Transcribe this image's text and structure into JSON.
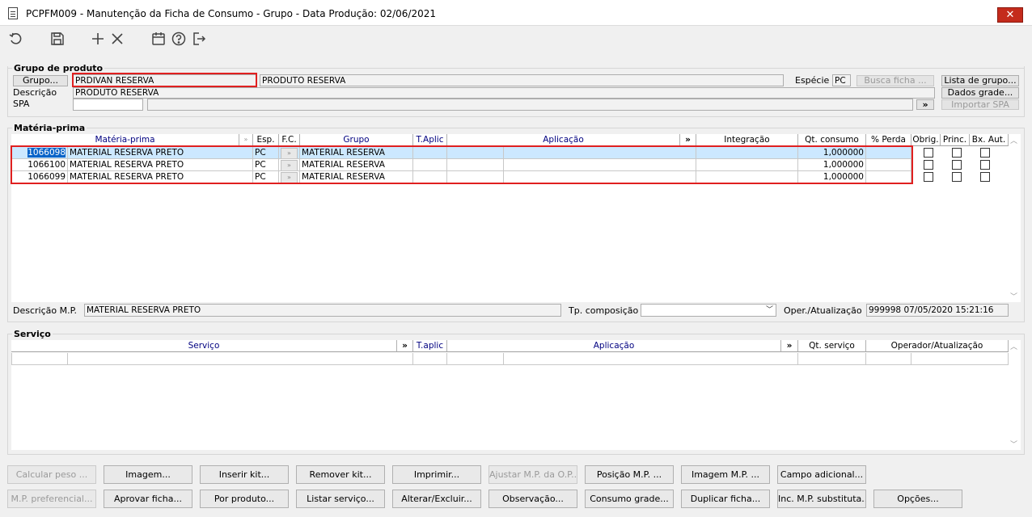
{
  "window": {
    "title": "PCPFM009 - Manutenção da Ficha de Consumo - Grupo - Data Produção: 02/06/2021",
    "close_label": "✕"
  },
  "toolbar": {
    "icons": [
      "undo-icon",
      "save-icon",
      "add-icon",
      "delete-icon",
      "calendar-icon",
      "help-icon",
      "exit-icon"
    ]
  },
  "grupo": {
    "title": "Grupo de produto",
    "grupo_button": "Grupo...",
    "grupo_code": "PRDIVAN RESERVA",
    "grupo_name": "PRODUTO RESERVA",
    "especie_label": "Espécie",
    "especie_value": "PC",
    "busca_ficha": "Busca ficha ...",
    "lista_grupo": "Lista de grupo...",
    "descricao_label": "Descrição",
    "descricao_value": "PRODUTO RESERVA",
    "dados_grade": "Dados grade...",
    "spa_label": "SPA",
    "spa_value": "",
    "spa_desc": "",
    "spa_more": "»",
    "importar_spa": "Importar SPA"
  },
  "mp": {
    "title": "Matéria-prima",
    "headers": {
      "materia": "Matéria-prima",
      "esp": "Esp.",
      "fc": "F.C.",
      "grupo": "Grupo",
      "taplic": "T.Aplic",
      "aplicacao": "Aplicação",
      "more": "»",
      "integracao": "Integração",
      "qt": "Qt. consumo",
      "perda": "% Perda",
      "obrig": "Obrig.",
      "princ": "Princ.",
      "bxaut": "Bx. Aut."
    },
    "rows": [
      {
        "code": "1066098",
        "desc": "MATERIAL RESERVA PRETO",
        "esp": "PC",
        "grupo": "MATERIAL RESERVA",
        "qt": "1,000000"
      },
      {
        "code": "1066100",
        "desc": "MATERIAL RESERVA PRETO",
        "esp": "PC",
        "grupo": "MATERIAL RESERVA",
        "qt": "1,000000"
      },
      {
        "code": "1066099",
        "desc": "MATERIAL RESERVA PRETO",
        "esp": "PC",
        "grupo": "MATERIAL RESERVA",
        "qt": "1,000000"
      }
    ],
    "descricao_label": "Descrição M.P.",
    "descricao_value": "MATERIAL RESERVA PRETO",
    "tp_label": "Tp. composição",
    "tp_value": "",
    "oper_label": "Oper./Atualização",
    "oper_user": "999998",
    "oper_date": "07/05/2020 15:21:16"
  },
  "servico": {
    "title": "Serviço",
    "headers": {
      "servico": "Serviço",
      "more1": "»",
      "taplic": "T.aplic",
      "aplicacao": "Aplicação",
      "more2": "»",
      "qt": "Qt. serviço",
      "oper": "Operador/Atualização"
    }
  },
  "buttons": {
    "row1": [
      "Calcular peso ...",
      "Imagem...",
      "Inserir kit...",
      "Remover kit...",
      "Imprimir...",
      "Ajustar M.P. da O.P...",
      "Posição M.P. ...",
      "Imagem M.P. ...",
      "Campo adicional..."
    ],
    "row2": [
      "M.P. preferencial...",
      "Aprovar ficha...",
      "Por produto...",
      "Listar serviço...",
      "Alterar/Excluir...",
      "Observação...",
      "Consumo grade...",
      "Duplicar ficha...",
      "Inc. M.P. substituta...",
      "Opções..."
    ]
  }
}
